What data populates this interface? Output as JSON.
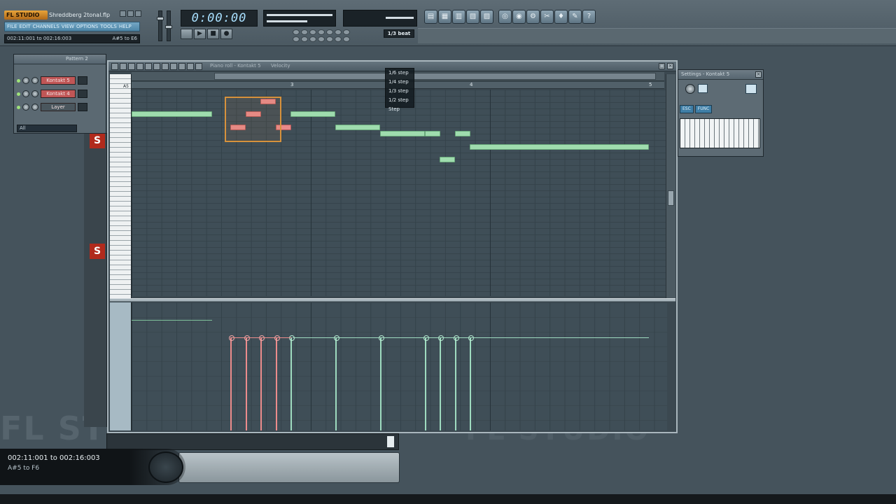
{
  "app": {
    "logo": "FL STUDIO",
    "project_file": "Shreddberg 2tonal.flp",
    "menu": [
      "FILE",
      "EDIT",
      "CHANNELS",
      "VIEW",
      "OPTIONS",
      "TOOLS",
      "HELP"
    ],
    "hint_range": "002:11:001 to 002:16:003",
    "hint_notes": "A#5 to E6",
    "time": "0:00:00",
    "transport": [
      "▶",
      "■",
      "●"
    ],
    "snap": "1/3 beat"
  },
  "channel_rack": {
    "title": "Pattern 2",
    "channels": [
      {
        "name": "Kontakt 5",
        "color": "#c05656"
      },
      {
        "name": "Kontakt 4",
        "color": "#c05656"
      },
      {
        "name": "Layer",
        "color": "#4a565d"
      }
    ],
    "filter": "All"
  },
  "piano_roll": {
    "title": "Piano roll - Kontakt 5",
    "target": "Velocity",
    "bar_numbers": [
      "3",
      "4",
      "5"
    ],
    "key_label": "A5"
  },
  "snap_menu": {
    "items": [
      "1/6 step",
      "1/4 step",
      "1/3 step",
      "1/2 step",
      "Step"
    ]
  },
  "instrument": {
    "title": "Settings - Kontakt 5",
    "tabs": [
      "ESC",
      "FUNC"
    ]
  },
  "status_overlay": {
    "range": "002:11:001 to 002:16:003",
    "notes": "A#5 to F6"
  },
  "watermark": "FL STUDIO",
  "colors": {
    "note_green": "#9fdcae",
    "note_red": "#e88a8a",
    "selection": "#d7923c",
    "accent_blue": "#4d86a8"
  }
}
